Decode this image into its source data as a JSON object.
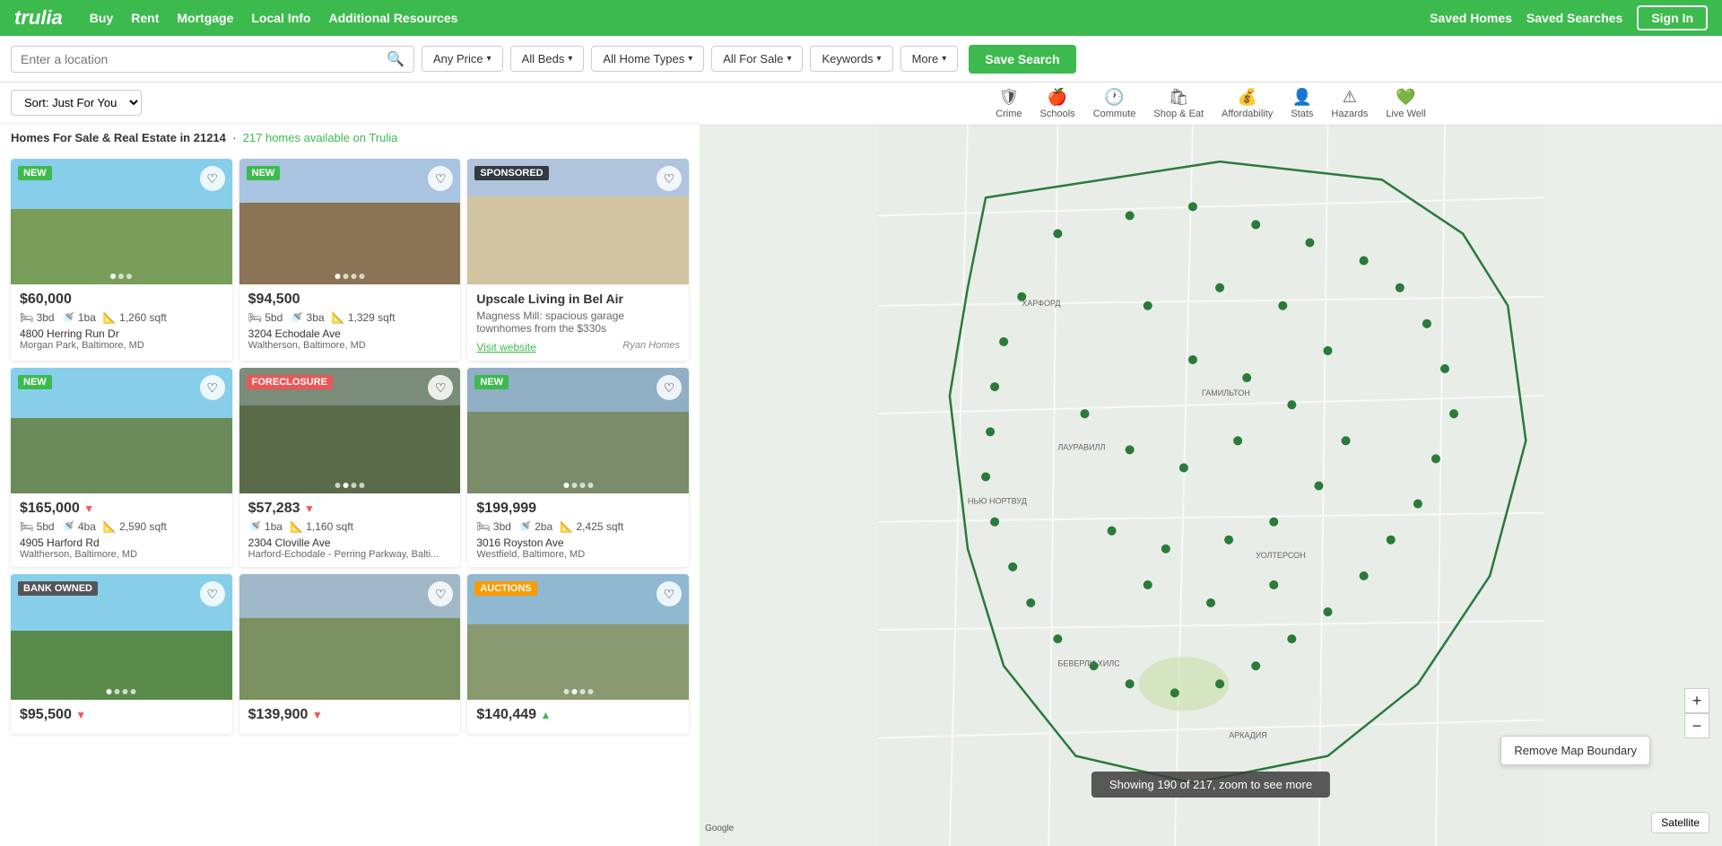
{
  "nav": {
    "logo": "trulia",
    "links": [
      "Buy",
      "Rent",
      "Mortgage",
      "Local Info",
      "Additional Resources"
    ],
    "right_links": [
      "Saved Homes",
      "Saved Searches"
    ],
    "sign_in": "Sign In"
  },
  "search": {
    "location_placeholder": "Enter a location",
    "filters": [
      {
        "id": "price",
        "label": "Any Price",
        "has_dropdown": true
      },
      {
        "id": "beds",
        "label": "All Beds",
        "has_dropdown": true
      },
      {
        "id": "home_types",
        "label": "All Home Types",
        "has_dropdown": true
      },
      {
        "id": "sale",
        "label": "All For Sale",
        "has_dropdown": true
      },
      {
        "id": "keywords",
        "label": "Keywords",
        "has_dropdown": true
      },
      {
        "id": "more",
        "label": "More",
        "has_dropdown": true
      }
    ],
    "save_label": "Save Search"
  },
  "sort": {
    "label": "Sort: Just For You"
  },
  "results": {
    "info": "Homes For Sale & Real Estate in 21214",
    "count": "217 homes available on Trulia",
    "link_text": "217 homes available on Trulia"
  },
  "map_icons": [
    {
      "id": "crime",
      "icon": "🛡",
      "label": "Crime"
    },
    {
      "id": "schools",
      "icon": "🍎",
      "label": "Schools"
    },
    {
      "id": "commute",
      "icon": "🕐",
      "label": "Commute"
    },
    {
      "id": "shop",
      "icon": "🛍",
      "label": "Shop & Eat"
    },
    {
      "id": "afford",
      "icon": "💰",
      "label": "Affordability"
    },
    {
      "id": "stats",
      "icon": "👤",
      "label": "Stats"
    },
    {
      "id": "hazards",
      "icon": "⚠",
      "label": "Hazards"
    },
    {
      "id": "livewell",
      "icon": "💚",
      "label": "Live Well"
    }
  ],
  "map": {
    "remove_boundary": "Remove Map Boundary",
    "status": "Showing 190 of 217, zoom to see more",
    "zoom_in": "+",
    "zoom_out": "−",
    "satellite": "Satellite",
    "google": "Google"
  },
  "listings": [
    {
      "id": 1,
      "badge": "NEW",
      "badge_type": "new",
      "price": "$60,000",
      "price_change": "",
      "beds": "3bd",
      "baths": "1ba",
      "sqft": "1,260 sqft",
      "address": "4800 Herring Run Dr",
      "location": "Morgan Park, Baltimore, MD",
      "img_class": "img-house1",
      "dots": 3,
      "active_dot": 1
    },
    {
      "id": 2,
      "badge": "NEW",
      "badge_type": "new",
      "price": "$94,500",
      "price_change": "",
      "beds": "5bd",
      "baths": "3ba",
      "sqft": "1,329 sqft",
      "address": "3204 Echodale Ave",
      "location": "Waltherson, Baltimore, MD",
      "img_class": "img-house2",
      "dots": 4,
      "active_dot": 1
    },
    {
      "id": 3,
      "badge": "SPONSORED",
      "badge_type": "sponsored",
      "price": "",
      "price_change": "",
      "beds": "",
      "baths": "",
      "sqft": "",
      "address": "",
      "location": "",
      "img_class": "img-house3",
      "sponsored_title": "Upscale Living in Bel Air",
      "sponsored_desc": "Magness Mill: spacious garage townhomes from the $330s",
      "sponsored_link": "Visit website",
      "sponsored_logo": "Ryan Homes",
      "dots": 0,
      "active_dot": 0
    },
    {
      "id": 4,
      "badge": "NEW",
      "badge_type": "new",
      "price": "$165,000",
      "price_change": "down",
      "beds": "5bd",
      "baths": "4ba",
      "sqft": "2,590 sqft",
      "address": "4905 Harford Rd",
      "location": "Waltherson, Baltimore, MD",
      "img_class": "img-house4",
      "dots": 0,
      "active_dot": 0
    },
    {
      "id": 5,
      "badge": "FORECLOSURE",
      "badge_type": "foreclosure",
      "price": "$57,283",
      "price_change": "down",
      "beds": "",
      "baths": "1ba",
      "sqft": "1,160 sqft",
      "address": "2304 Cloville Ave",
      "location": "Harford-Echodale - Perring Parkway, Balti...",
      "img_class": "img-house5",
      "dots": 4,
      "active_dot": 2
    },
    {
      "id": 6,
      "badge": "NEW",
      "badge_type": "new",
      "price": "$199,999",
      "price_change": "",
      "beds": "3bd",
      "baths": "2ba",
      "sqft": "2,425 sqft",
      "address": "3016 Royston Ave",
      "location": "Westfield, Baltimore, MD",
      "img_class": "img-house6",
      "dots": 4,
      "active_dot": 1
    },
    {
      "id": 7,
      "badge": "BANK OWNED",
      "badge_type": "bank-owned",
      "price": "$95,500",
      "price_change": "down",
      "beds": "",
      "baths": "",
      "sqft": "",
      "address": "",
      "location": "",
      "img_class": "img-house7",
      "dots": 4,
      "active_dot": 1
    },
    {
      "id": 8,
      "badge": "",
      "badge_type": "",
      "price": "$139,900",
      "price_change": "down",
      "beds": "",
      "baths": "",
      "sqft": "",
      "address": "",
      "location": "",
      "img_class": "img-house8",
      "dots": 0,
      "active_dot": 0
    },
    {
      "id": 9,
      "badge": "AUCTIONS",
      "badge_type": "auctions",
      "price": "$140,449",
      "price_change": "up",
      "beds": "",
      "baths": "",
      "sqft": "",
      "address": "",
      "location": "",
      "img_class": "img-house9",
      "dots": 4,
      "active_dot": 2
    }
  ]
}
